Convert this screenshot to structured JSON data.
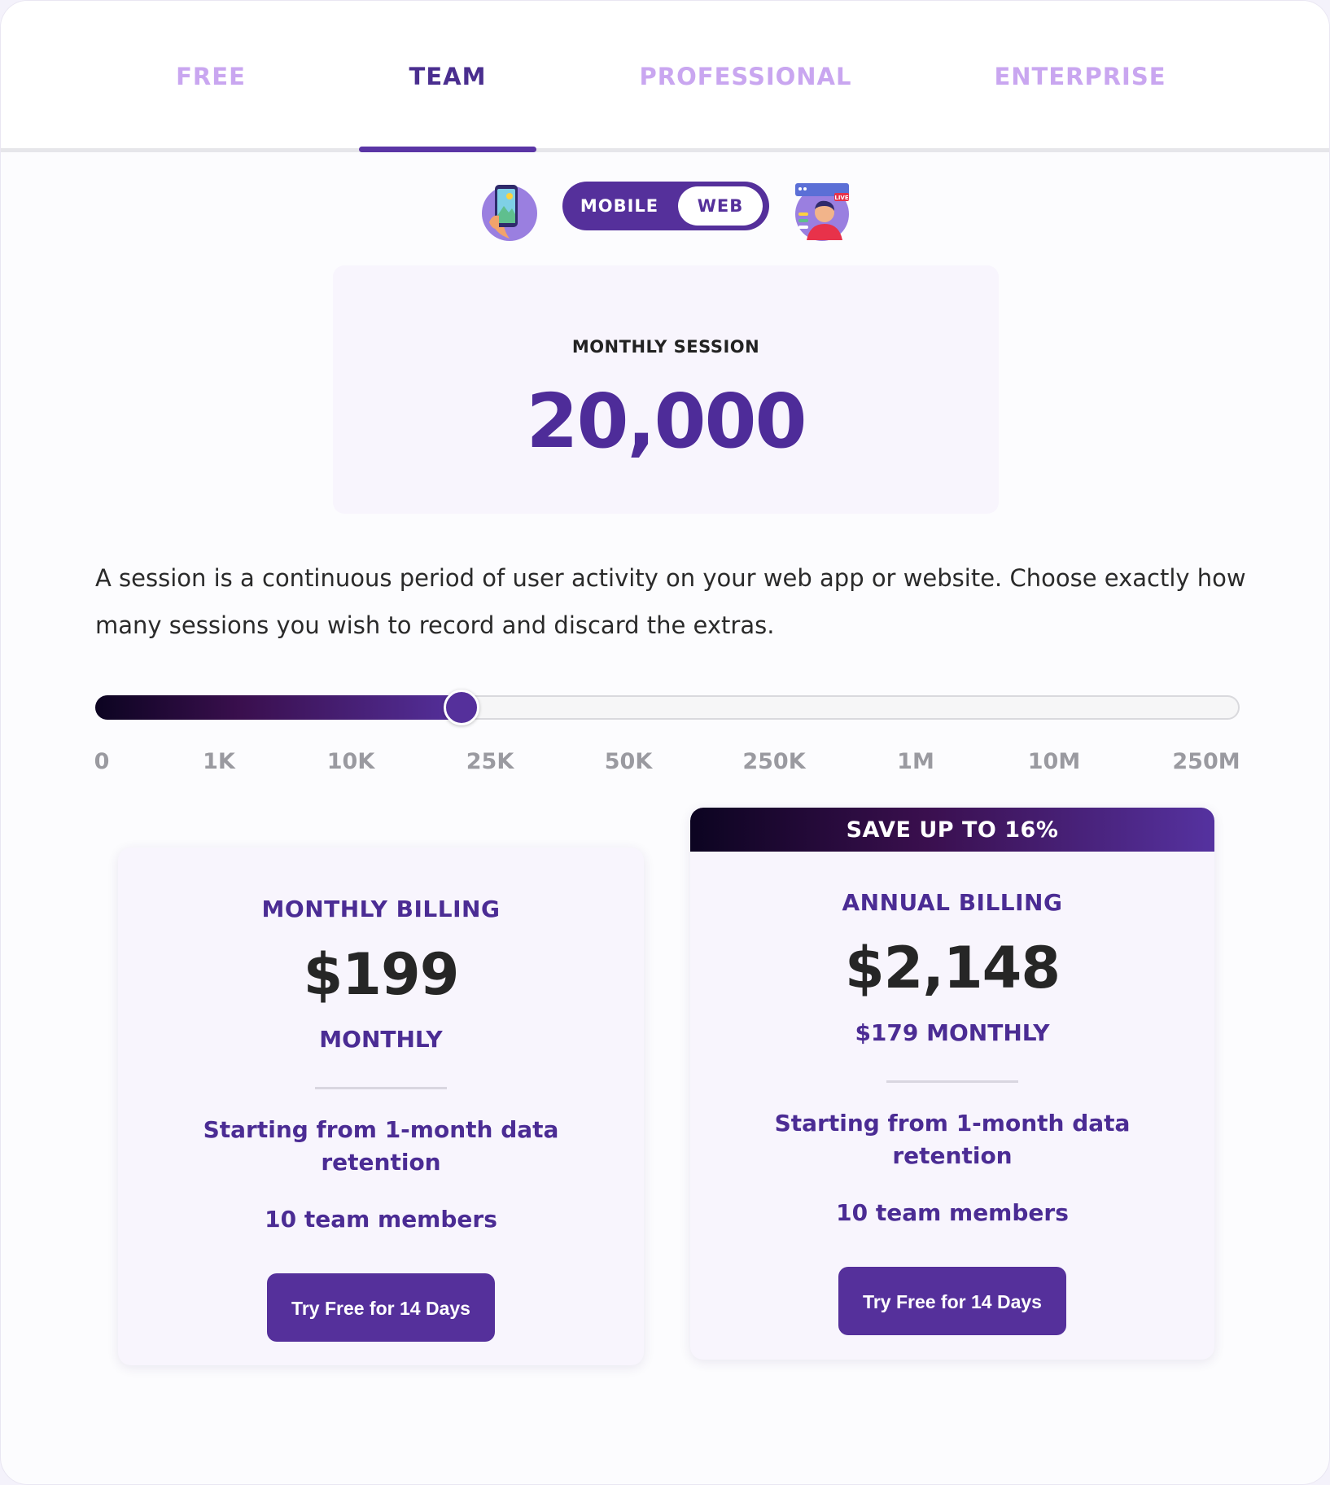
{
  "tabs": [
    {
      "label": "FREE",
      "active": false
    },
    {
      "label": "TEAM",
      "active": true
    },
    {
      "label": "PROFESSIONAL",
      "active": false
    },
    {
      "label": "ENTERPRISE",
      "active": false
    }
  ],
  "platform_toggle": {
    "mobile_label": "MOBILE",
    "web_label": "WEB",
    "selected": "WEB",
    "live_badge": "LIVE"
  },
  "session": {
    "label": "MONTHLY SESSION",
    "value": "20,000"
  },
  "description": "A session is a continuous period of user activity on your web app or website. Choose exactly how many sessions you wish to record and discard the extras.",
  "slider": {
    "ticks": [
      "0",
      "1K",
      "10K",
      "25K",
      "50K",
      "250K",
      "1M",
      "10M",
      "250M"
    ],
    "position_fraction": 0.32
  },
  "monthly_card": {
    "title": "MONTHLY BILLING",
    "price": "$199",
    "period": "MONTHLY",
    "retention": "Starting from 1-month data retention",
    "members": "10 team members",
    "cta": "Try Free for 14 Days"
  },
  "annual_card": {
    "banner": "SAVE UP TO 16%",
    "title": "ANNUAL BILLING",
    "price": "$2,148",
    "period": "$179 MONTHLY",
    "retention": "Starting from 1-month data retention",
    "members": "10 team members",
    "cta": "Try Free for 14 Days"
  },
  "colors": {
    "accent": "#55309b",
    "tab_inactive": "#c9a6f0",
    "tab_active": "#4a2e8f",
    "card_bg": "#f8f5fd",
    "gradient_dark": "#0c0421"
  }
}
